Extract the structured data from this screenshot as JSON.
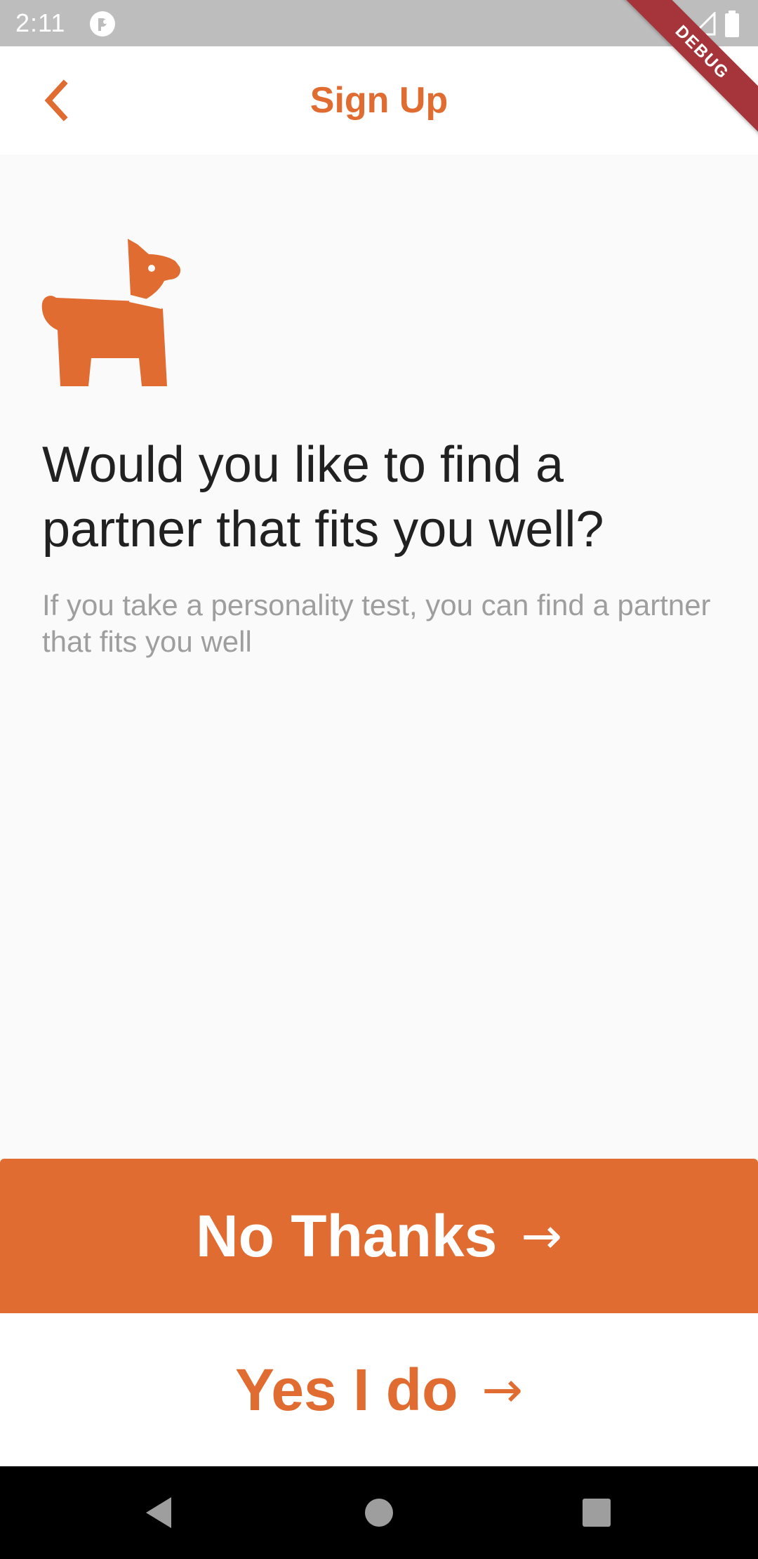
{
  "status_bar": {
    "time": "2:11",
    "icons": [
      "app-notification-icon",
      "wifi-icon",
      "signal-icon",
      "battery-icon"
    ]
  },
  "debug_banner": "DEBUG",
  "app_bar": {
    "title": "Sign Up",
    "back_icon": "chevron-left-icon"
  },
  "content": {
    "icon": "dog-icon",
    "headline": "Would you like to find a partner that fits you well?",
    "subtext": "If you take a personality test, you can find a partner that fits you well"
  },
  "buttons": {
    "no_label": "No Thanks",
    "yes_label": "Yes I do",
    "arrow": "→"
  },
  "nav_bar": {
    "icons": [
      "back-triangle-icon",
      "home-circle-icon",
      "recents-square-icon"
    ]
  },
  "colors": {
    "accent": "#e06c31",
    "background": "#fafafa",
    "status_bar": "#bdbdbd",
    "headline": "#212121",
    "subtext": "#9e9e9e"
  }
}
